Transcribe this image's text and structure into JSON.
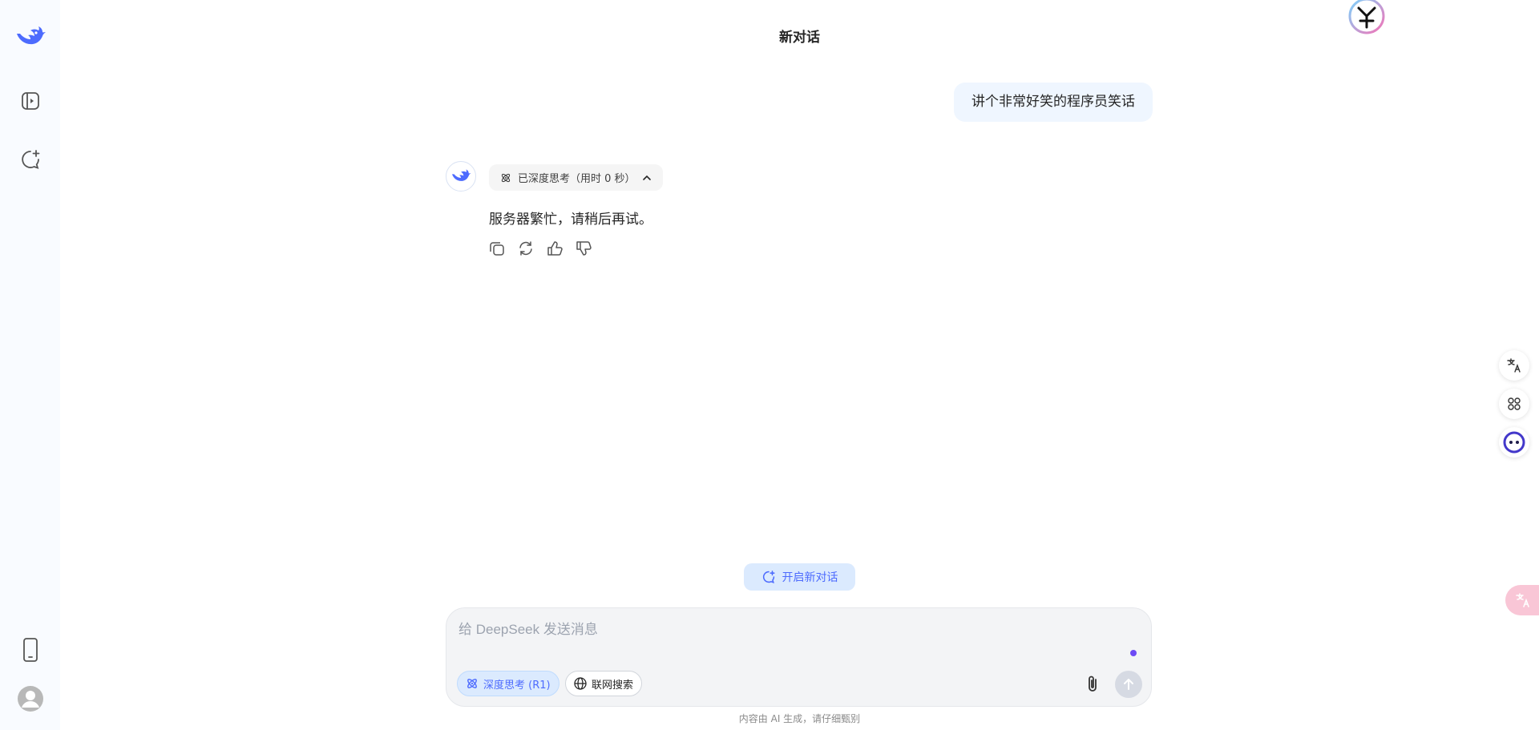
{
  "app": {
    "title": "新对话"
  },
  "sidebar": {
    "icons": [
      "deepseek-logo-icon",
      "open-sidebar-icon",
      "new-chat-icon",
      "mobile-app-icon",
      "user-avatar-icon"
    ]
  },
  "conversation": {
    "user_message": "讲个非常好笑的程序员笑话",
    "thinking_label": "已深度思考（用时 0 秒）",
    "reply": "服务器繁忙，请稍后再试。"
  },
  "new_chat_button": "开启新对话",
  "composer": {
    "placeholder": "给 DeepSeek 发送消息",
    "deep_think_label": "深度思考 (R1)",
    "web_search_label": "联网搜索"
  },
  "footer": {
    "disclaimer": "内容由 AI 生成，请仔细甄别"
  },
  "colors": {
    "accent": "#4d6bfe",
    "sidebar_bg": "#f9fbff",
    "user_bubble": "#eff6ff"
  }
}
